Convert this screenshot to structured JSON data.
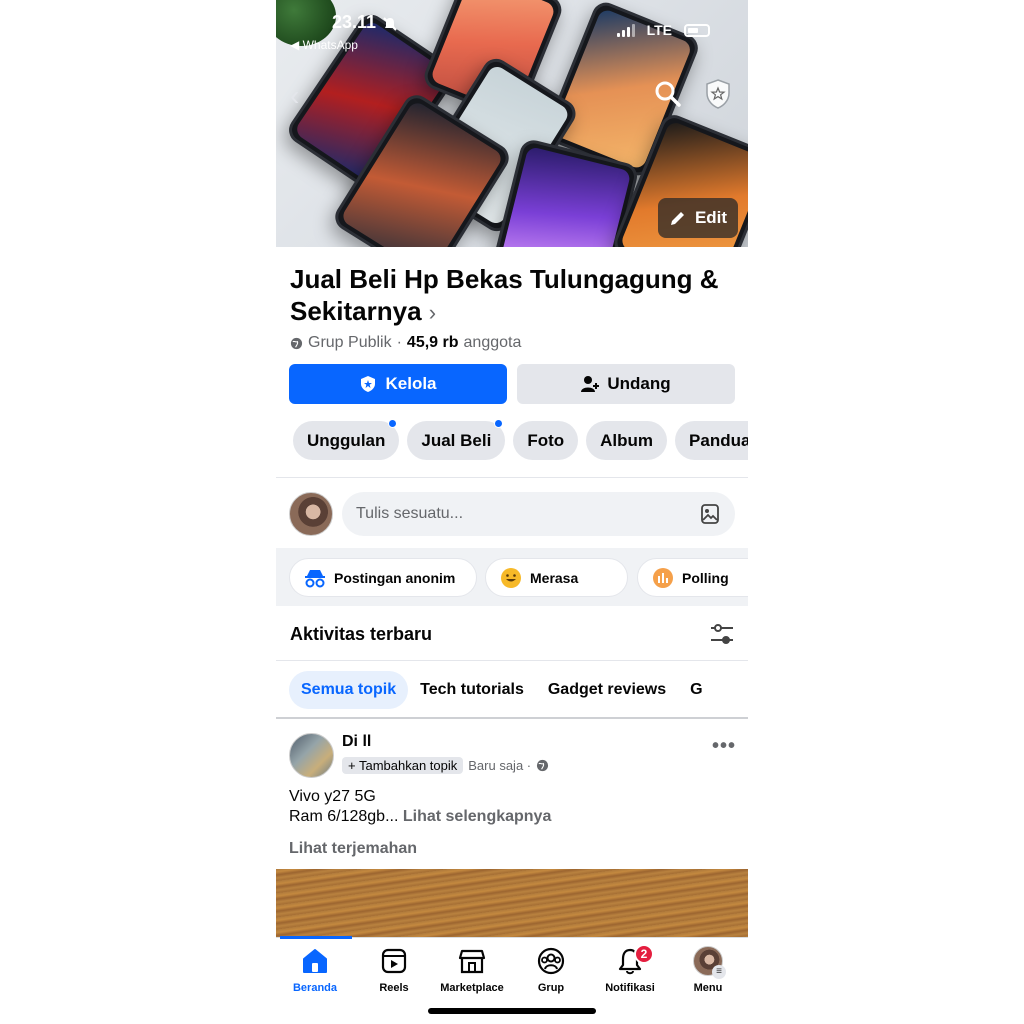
{
  "status_bar": {
    "time": "23.11",
    "back_app": "◀ WhatsApp",
    "network": "LTE"
  },
  "cover": {
    "edit_label": "Edit"
  },
  "group": {
    "title": "Jual Beli Hp Bekas Tulungagung & Sekitarnya",
    "privacy": "Grup Publik",
    "members_count": "45,9 rb",
    "members_label": "anggota"
  },
  "buttons": {
    "manage": "Kelola",
    "invite": "Undang"
  },
  "tabs": [
    "Unggulan",
    "Jual Beli",
    "Foto",
    "Album",
    "Panduan"
  ],
  "composer": {
    "placeholder": "Tulis sesuatu..."
  },
  "quick_actions": {
    "anonymous": "Postingan anonim",
    "feeling": "Merasa",
    "poll": "Polling"
  },
  "activity": {
    "title": "Aktivitas terbaru",
    "topics": [
      "Semua topik",
      "Tech tutorials",
      "Gadget reviews",
      "G"
    ]
  },
  "post": {
    "author": "Di ll",
    "add_topic": "+ Tambahkan topik",
    "time": "Baru saja ·",
    "line1": "Vivo y27 5G",
    "line2": "Ram 6/128gb...",
    "see_more": "Lihat selengkapnya",
    "translate": "Lihat terjemahan"
  },
  "nav": {
    "home": "Beranda",
    "reels": "Reels",
    "marketplace": "Marketplace",
    "groups": "Grup",
    "notifications": "Notifikasi",
    "notifications_badge": "2",
    "menu": "Menu"
  },
  "colors": {
    "accent": "#0866ff",
    "badge": "#e41e3f",
    "chip_bg": "#e4e6eb"
  }
}
